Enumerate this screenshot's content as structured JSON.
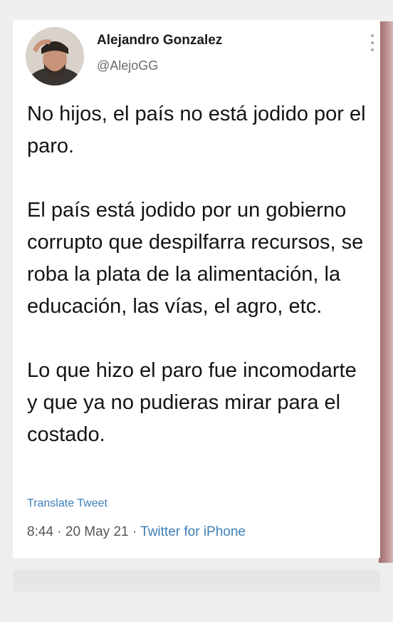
{
  "author": {
    "name": "Alejandro Gonzalez",
    "handle": "@AlejoGG"
  },
  "tweet": {
    "paragraphs": [
      "No hijos, el país no está jodido por el paro.",
      "El país está jodido por un gobierno corrupto que despilfarra recursos, se roba la plata de la alimentación, la educación, las vías, el agro, etc.",
      "Lo que hizo el paro fue incomodarte y que ya no pudieras mirar para el costado."
    ],
    "translate_label": "Translate Tweet",
    "time": "8:44",
    "date": "20 May 21",
    "source": "Twitter for iPhone",
    "separator": " · "
  },
  "colors": {
    "link": "#3f7fb6",
    "text": "#141414",
    "muted": "#6b6b6b",
    "edge": "#b88787"
  },
  "icons": [
    "avatar-photo",
    "more-vertical-icon"
  ]
}
